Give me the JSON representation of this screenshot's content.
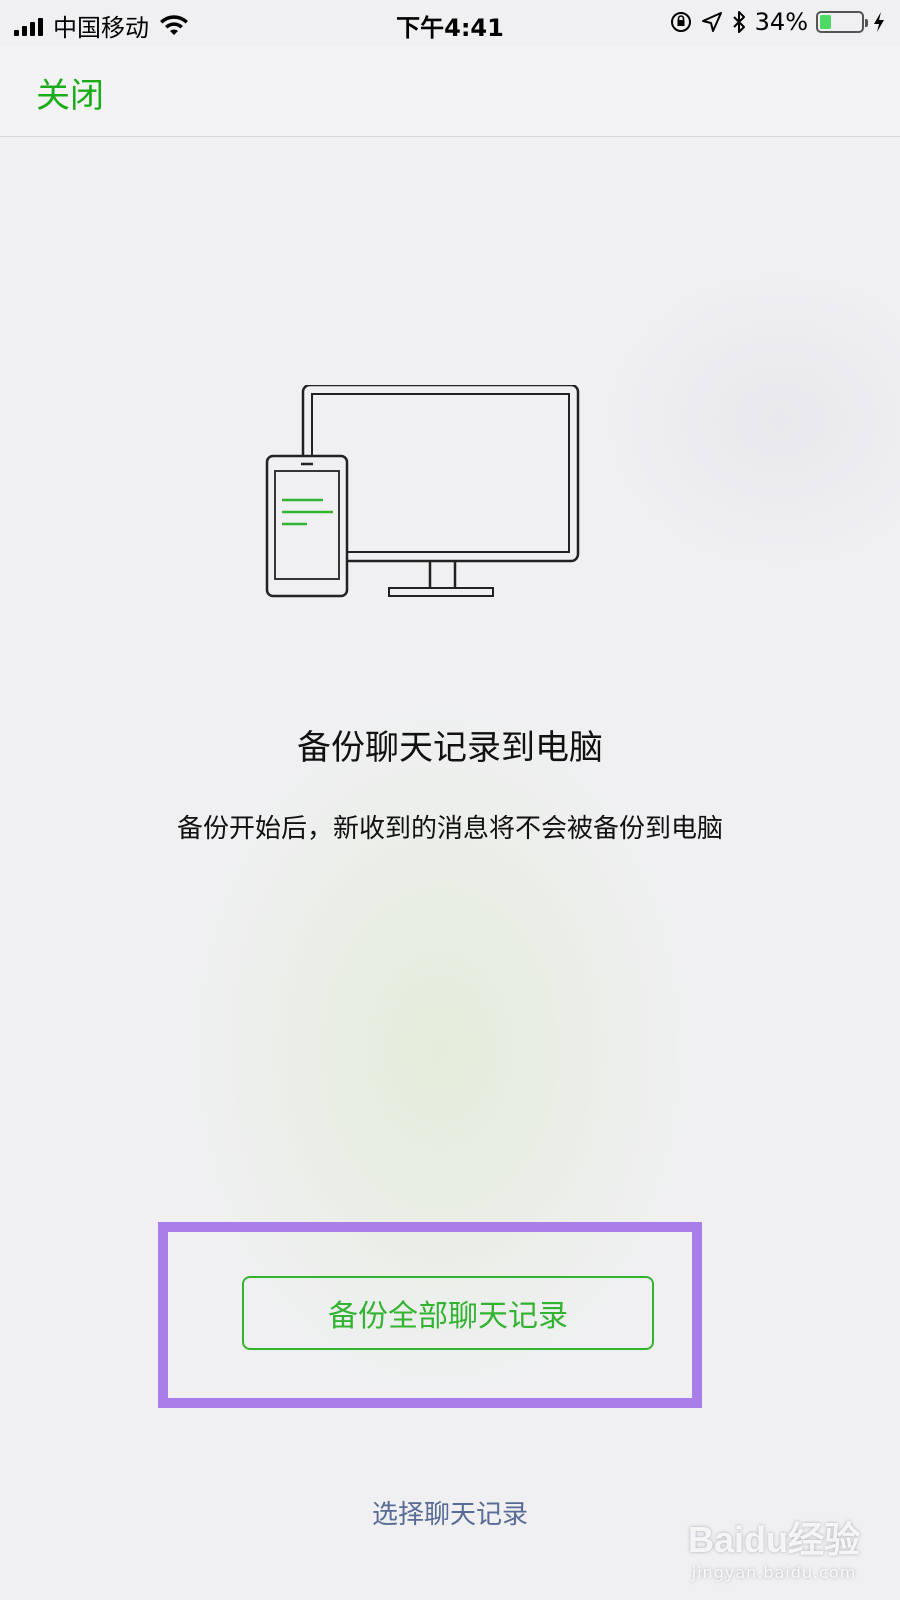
{
  "status_bar": {
    "carrier": "中国移动",
    "time": "下午4:41",
    "battery_percent_text": "34%",
    "battery_level": 0.34,
    "battery_color": "#4cd964",
    "icons": [
      "signal-icon",
      "wifi-icon",
      "orientation-lock-icon",
      "location-icon",
      "bluetooth-icon",
      "battery-icon",
      "charging-icon"
    ]
  },
  "nav": {
    "close_label": "关闭",
    "accent_color": "#1aad19"
  },
  "illustration": {
    "icons": [
      "phone-icon",
      "monitor-icon"
    ]
  },
  "main": {
    "title": "备份聊天记录到电脑",
    "description": "备份开始后，新收到的消息将不会被备份到电脑"
  },
  "actions": {
    "backup_all_label": "备份全部聊天记录",
    "select_chats_label": "选择聊天记录",
    "highlight_color": "#a97ee9",
    "link_color": "#576b95"
  },
  "watermark": {
    "logo_text": "Baidu经验",
    "url": "jingyan.baidu.com"
  }
}
